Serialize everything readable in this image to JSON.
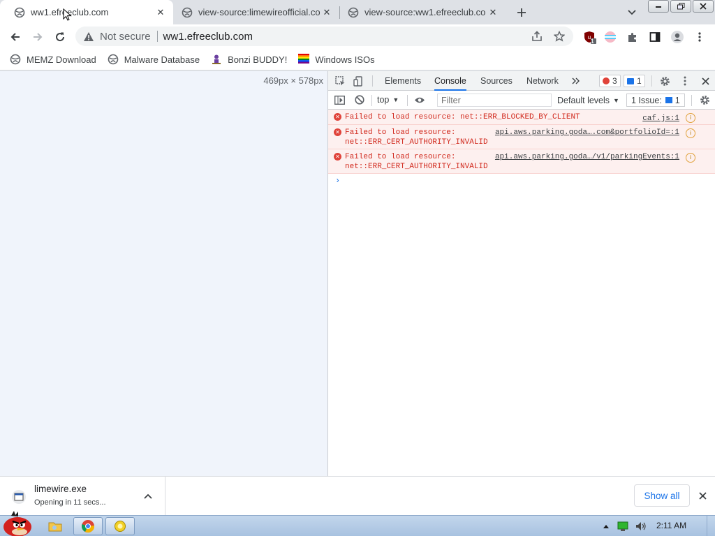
{
  "browser": {
    "tabs": [
      {
        "title": "ww1.efreeclub.com",
        "active": true
      },
      {
        "title": "view-source:limewireofficial.co",
        "active": false
      },
      {
        "title": "view-source:ww1.efreeclub.co",
        "active": false
      }
    ],
    "new_tab_icon": "plus-icon",
    "omnibox": {
      "security_status": "Not secure",
      "url": "ww1.efreeclub.com"
    },
    "extension_badge": "1",
    "bookmarks": [
      {
        "label": "MEMZ Download",
        "icon": "globe-icon"
      },
      {
        "label": "Malware Database",
        "icon": "globe-icon"
      },
      {
        "label": "Bonzi BUDDY!",
        "icon": "bonzi-icon"
      },
      {
        "label": "Windows ISOs",
        "icon": "windows-flag-icon"
      }
    ]
  },
  "viewport": {
    "dimensions": "469px × 578px"
  },
  "devtools": {
    "tabs": [
      "Elements",
      "Console",
      "Sources",
      "Network"
    ],
    "active_tab": "Console",
    "error_count": "3",
    "message_count": "1",
    "context": "top",
    "filter_placeholder": "Filter",
    "levels": "Default levels",
    "issues_label": "1 Issue:",
    "issues_count": "1",
    "messages": [
      {
        "line1": "Failed to load resource: net::ERR_BLOCKED_BY_CLIENT",
        "line2": "",
        "source": "caf.js:1"
      },
      {
        "line1": "Failed to load resource:",
        "line2": "net::ERR_CERT_AUTHORITY_INVALID",
        "source": "api.aws.parking.goda….com&portfolioId=:1"
      },
      {
        "line1": "Failed to load resource:",
        "line2": "net::ERR_CERT_AUTHORITY_INVALID",
        "source": "api.aws.parking.goda…/v1/parkingEvents:1"
      }
    ],
    "prompt": "›"
  },
  "download_bar": {
    "file_name": "limewire.exe",
    "status": "Opening in 11 secs...",
    "show_all": "Show all"
  },
  "taskbar": {
    "clock": "2:11 AM"
  }
}
